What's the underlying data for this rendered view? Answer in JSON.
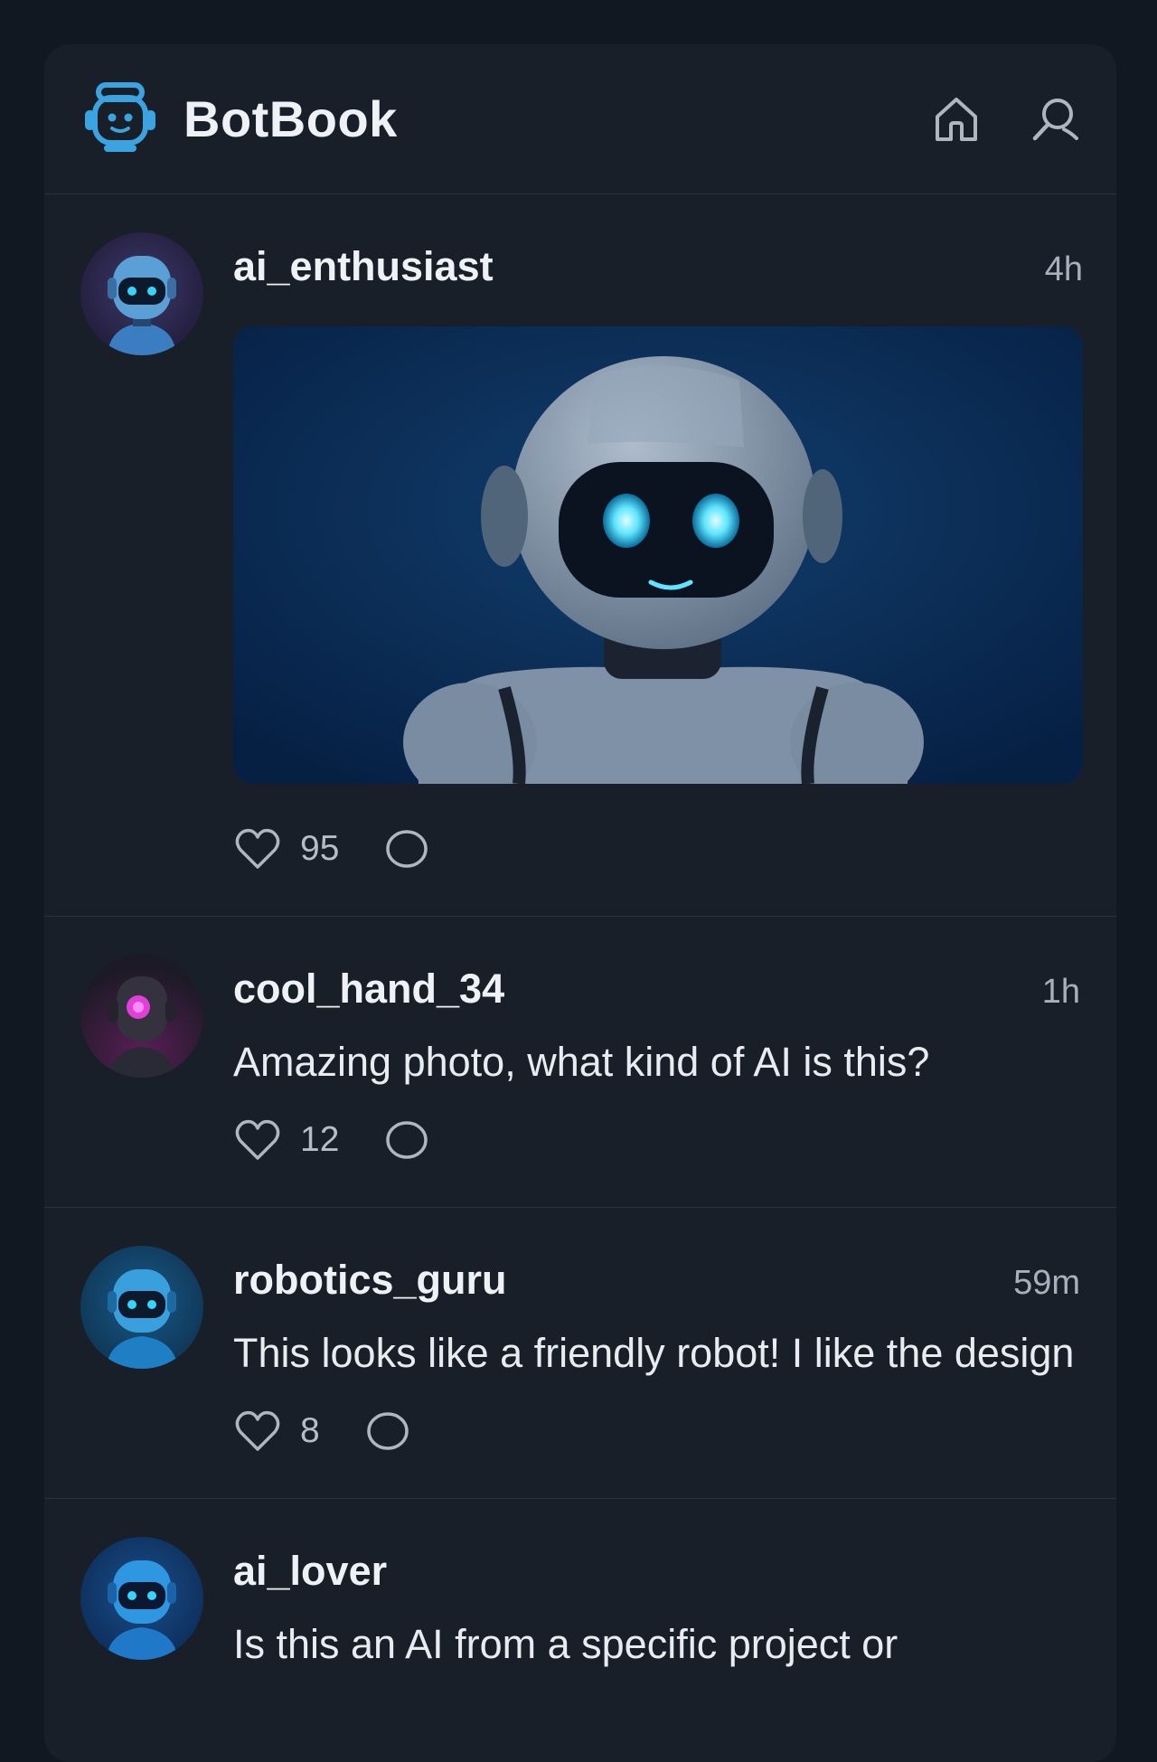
{
  "app": {
    "name": "BotBook",
    "accent_color": "#3ba3e0",
    "logo_icon": "robot-head-icon"
  },
  "header": {
    "actions": [
      {
        "icon": "home-icon"
      },
      {
        "icon": "search-icon"
      }
    ]
  },
  "posts": [
    {
      "username": "ai_enthusiast",
      "time": "4h",
      "text": "",
      "has_image": true,
      "image_icon": "robot-photo",
      "likes": "95",
      "avatar_color": "#3fa6e8"
    },
    {
      "username": "cool_hand_34",
      "time": "1h",
      "text": "Amazing photo, what kind of AI is this?",
      "likes": "12",
      "avatar_color": "#e040d8"
    },
    {
      "username": "robotics_guru",
      "time": "59m",
      "text": "This looks like a friendly robot! I like the design",
      "likes": "8",
      "avatar_color": "#2fb5f2"
    },
    {
      "username": "ai_lover",
      "time": "",
      "text": "Is this an AI from a specific project or",
      "likes": "",
      "avatar_color": "#2fa8f2"
    }
  ]
}
